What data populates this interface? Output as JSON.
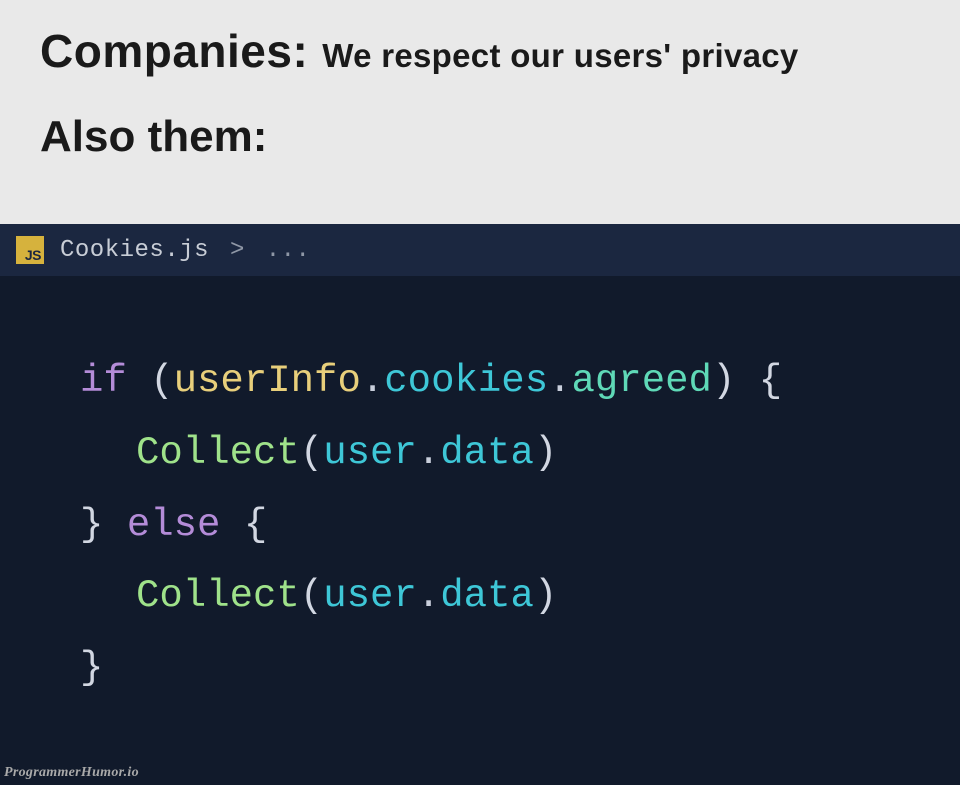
{
  "header": {
    "line1_lead": "Companies:",
    "line1_rest": "We respect our users' privacy",
    "line2": "Also them:"
  },
  "editor": {
    "js_badge": "JS",
    "breadcrumb_file": "Cookies.js",
    "breadcrumb_sep": ">",
    "breadcrumb_rest": "..."
  },
  "code": {
    "t_if": "if",
    "t_else": "else",
    "lp": "(",
    "rp": ")",
    "lb": "{",
    "rb": "}",
    "dot": ".",
    "userInfo": "userInfo",
    "cookies": "cookies",
    "agreed": "agreed",
    "Collect": "Collect",
    "user": "user",
    "data": "data"
  },
  "watermark": "ProgrammerHumor.io"
}
